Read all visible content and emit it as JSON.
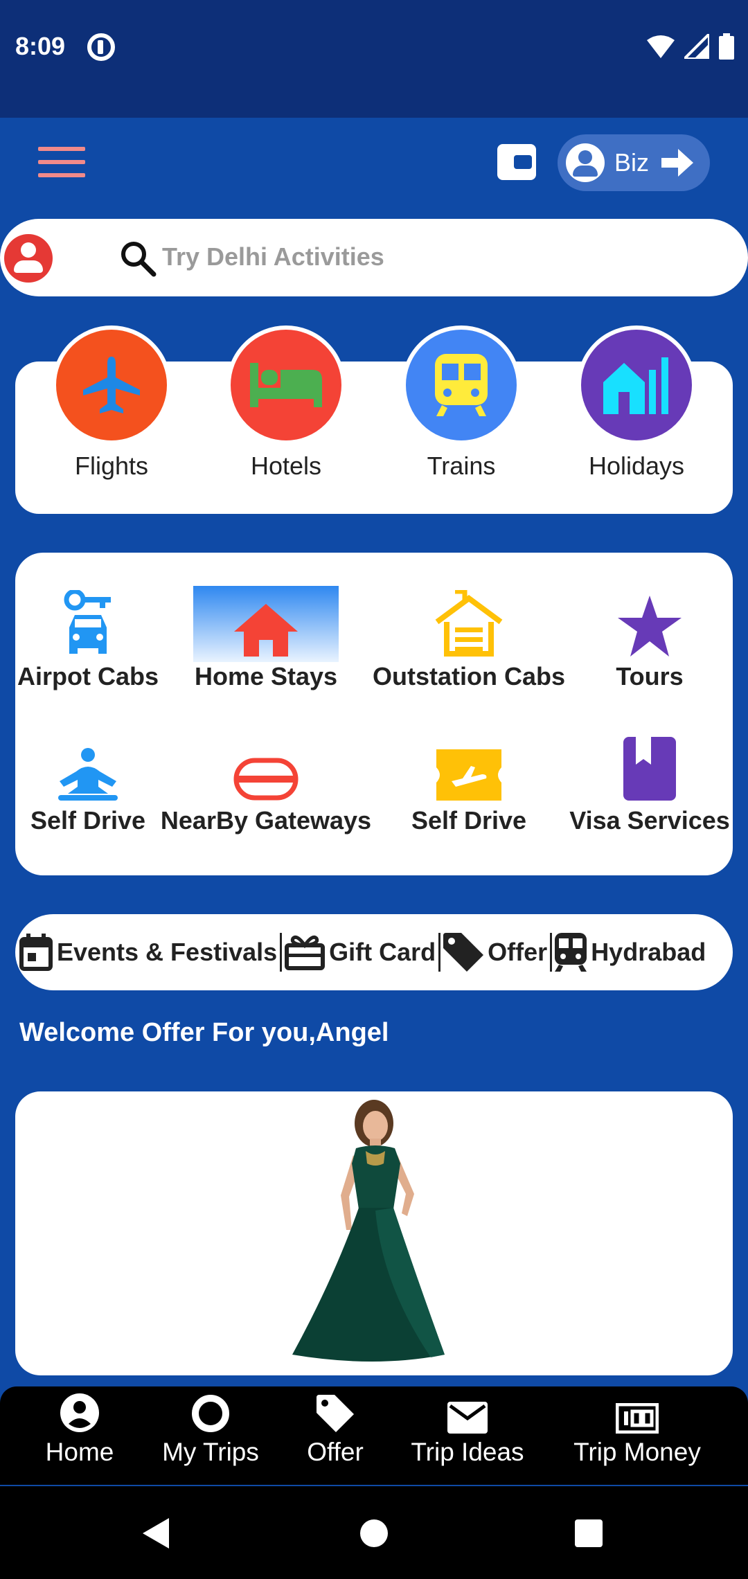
{
  "status_bar": {
    "time": "8:09"
  },
  "header": {
    "biz_label": "Biz"
  },
  "search": {
    "placeholder": "Try Delhi Activities"
  },
  "categories": [
    {
      "label": "Flights",
      "icon": "airplane-icon",
      "color": "#f4511e"
    },
    {
      "label": "Hotels",
      "icon": "bed-icon",
      "color": "#f44336"
    },
    {
      "label": "Trains",
      "icon": "train-icon",
      "color": "#4285f4"
    },
    {
      "label": "Holidays",
      "icon": "holiday-home-icon",
      "color": "#673ab7"
    }
  ],
  "services": [
    {
      "label": "Airpot Cabs",
      "icon": "cab-icon",
      "active": false
    },
    {
      "label": "Home Stays",
      "icon": "home-icon",
      "active": true
    },
    {
      "label": "Outstation Cabs",
      "icon": "house-outline-icon",
      "active": false
    },
    {
      "label": "Tours",
      "icon": "star-icon",
      "active": false
    },
    {
      "label": "Self Drive",
      "icon": "meditation-icon",
      "active": false
    },
    {
      "label": "NearBy Gateways",
      "icon": "no-entry-icon",
      "active": false
    },
    {
      "label": "Self Drive",
      "icon": "ticket-flight-icon",
      "active": false
    },
    {
      "label": "Visa Services",
      "icon": "book-icon",
      "active": false
    }
  ],
  "tags": [
    {
      "label": "Events & Festivals",
      "icon": "calendar-icon"
    },
    {
      "label": "Gift Card",
      "icon": "gift-icon"
    },
    {
      "label": "Offer",
      "icon": "tag-icon"
    },
    {
      "label": "Hydrabad",
      "icon": "train-small-icon"
    }
  ],
  "welcome_text": "Welcome Offer For you,Angel",
  "bottom_nav": [
    {
      "label": "Home",
      "icon": "account-circle-icon"
    },
    {
      "label": "My Trips",
      "icon": "ring-icon"
    },
    {
      "label": "Offer",
      "icon": "tag-icon"
    },
    {
      "label": "Trip Ideas",
      "icon": "mail-icon"
    },
    {
      "label": "Trip Money",
      "icon": "money-icon"
    }
  ],
  "colors": {
    "background": "#0f4aa6",
    "status_bar": "#0d2f78",
    "accent_red": "#e53935"
  }
}
